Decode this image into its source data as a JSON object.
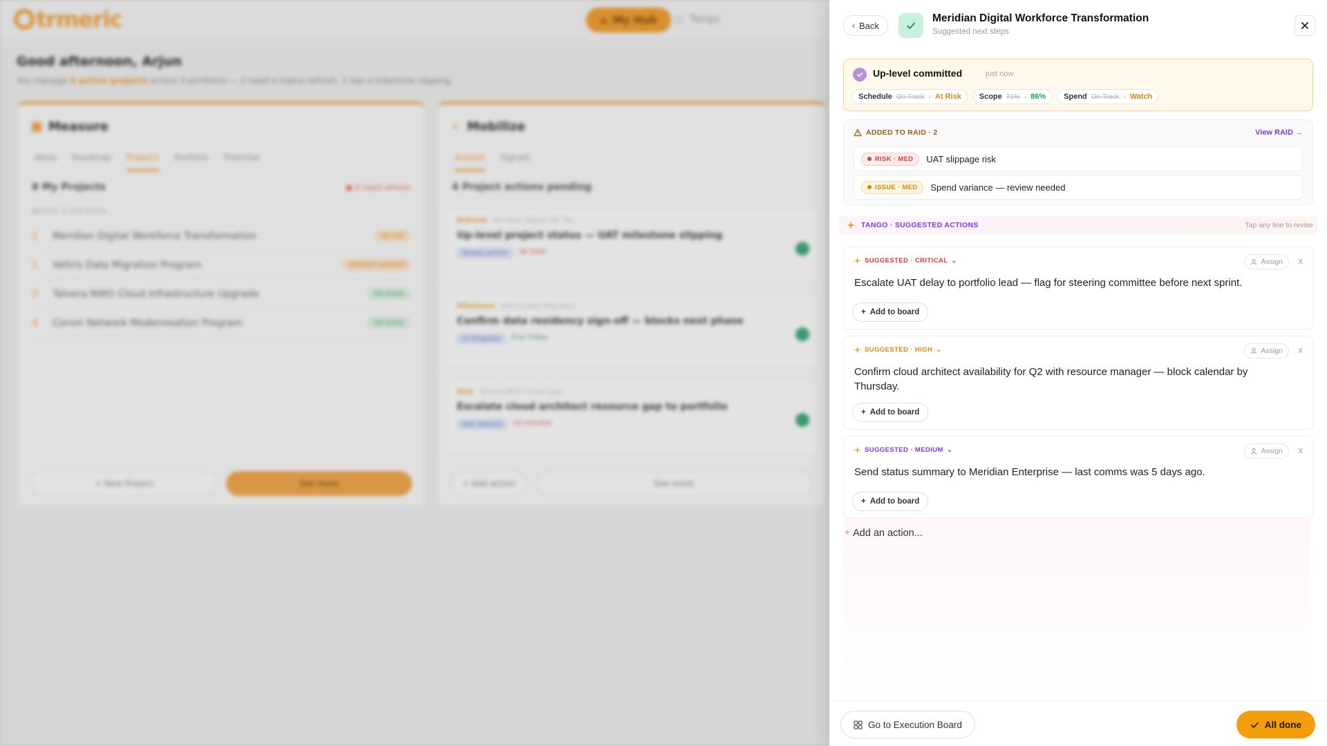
{
  "background": {
    "logo_text": "trmeric",
    "nav": {
      "hub_label": "My Hub",
      "tango_label": "Tango"
    },
    "greeting": "Good afternoon, Arjun",
    "greeting_sub_pre": "You manage ",
    "greeting_sub_highlight": "4 active projects",
    "greeting_sub_post": " across 3 portfolios — 2 need a status refresh, 1 has a milestone slipping.",
    "measure": {
      "title": "Measure",
      "tabs": [
        "Ideas",
        "Roadmap",
        "Projects",
        "Portfolio",
        "Potential"
      ],
      "section_title": "8  My Projects",
      "section_note": "● X need refresh",
      "small_caption": "NEEDS A REFRESH",
      "projects": [
        {
          "num": "1",
          "name": "Meridian Digital Workforce Transformation",
          "status": "At risk",
          "tone": "orange"
        },
        {
          "num": "1",
          "name": "Veltris Data Migration Program",
          "status": "Refresh needed",
          "tone": "orange"
        },
        {
          "num": "3",
          "name": "Talvera NWO Cloud Infrastructure Upgrade",
          "status": "On track",
          "tone": "green"
        },
        {
          "num": "4",
          "name": "Corvin Network Modernisation Program",
          "status": "On track",
          "tone": "green"
        }
      ],
      "new_project": "+ New Project",
      "see_more": "See more"
    },
    "mobilize": {
      "title": "Mobilize",
      "tabs": [
        "Actions",
        "Signals"
      ],
      "section_title": "4  Project actions pending",
      "actions": [
        {
          "tag": "Refresh",
          "project": "Meridian Digital WF Tra...",
          "title": "Up-level project status — UAT milestone slipping",
          "chip": "Needs action",
          "extra": "3d stale"
        },
        {
          "tag": "Milestone",
          "project": "Veltris Data Migration",
          "title": "Confirm data residency sign-off — blocks next phase",
          "chip": "In Progress",
          "extra": "Due today"
        },
        {
          "tag": "Risk",
          "project": "Talvera NWO Cloud Upg...",
          "title": "Escalate cloud architect resource gap to portfolio",
          "chip": "Not started",
          "extra": "1d overdue"
        }
      ],
      "add_action": "+ Add action",
      "see_more": "See more"
    }
  },
  "drawer": {
    "back_label": "Back",
    "title": "Meridian Digital Workforce Transformation",
    "subtitle": "Suggested next steps",
    "commit": {
      "title": "Up-level committed",
      "time": "just now",
      "metrics": [
        {
          "key": "Schedule",
          "old": "On Track",
          "new": "At Risk",
          "color": "#e08a0b"
        },
        {
          "key": "Scope",
          "old": "71%",
          "new": "86%",
          "color": "#16a36a"
        },
        {
          "key": "Spend",
          "old": "On Track",
          "new": "Watch",
          "color": "#e08a0b"
        }
      ]
    },
    "raid": {
      "heading": "ADDED TO RAID · 2",
      "link": "View RAID →",
      "items": [
        {
          "tag": "RISK · MED",
          "text": "UAT slippage risk"
        },
        {
          "tag": "ISSUE · MED",
          "text": "Spend variance — review needed"
        }
      ]
    },
    "suggested_header": "TANGO · SUGGESTED ACTIONS",
    "suggested_hint": "Tap any line to revise",
    "cards": [
      {
        "tag": "SUGGESTED · CRITICAL",
        "color": "#dc3b33",
        "text": "Escalate UAT delay to portfolio lead — flag for steering committee before next sprint.",
        "assign": "Assign",
        "add": "Add to board"
      },
      {
        "tag": "SUGGESTED · HIGH",
        "color": "#e0860b",
        "text": "Confirm cloud architect availability for Q2 with resource manager — block calendar by Thursday.",
        "assign": "Assign",
        "add": "Add to board"
      },
      {
        "tag": "SUGGESTED · MEDIUM",
        "color": "#7c3aed",
        "text": "Send status summary to Meridian Enterprise — last comms was 5 days ago.",
        "assign": "Assign",
        "add": "Add to board"
      }
    ],
    "add_action_placeholder": "Add an action...",
    "footer": {
      "exec_label": "Go to Execution Board",
      "done_label": "All done"
    }
  }
}
